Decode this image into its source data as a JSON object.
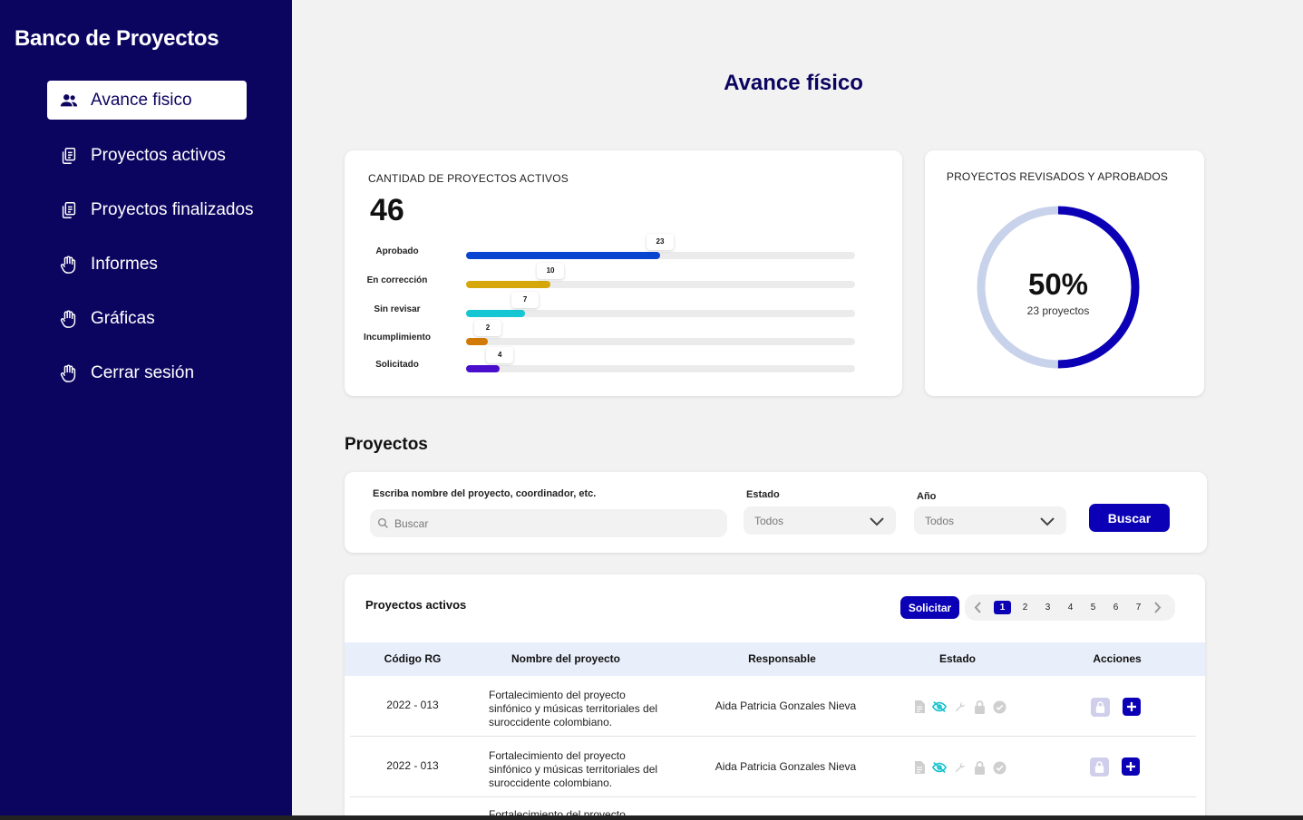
{
  "sidebar": {
    "brand": "Banco de Proyectos",
    "items": [
      {
        "label": "Avance fisico",
        "icon": "users-icon",
        "active": true
      },
      {
        "label": "Proyectos activos",
        "icon": "documents-icon"
      },
      {
        "label": "Proyectos finalizados",
        "icon": "documents-icon"
      },
      {
        "label": "Informes",
        "icon": "hand-icon"
      },
      {
        "label": "Gráficas",
        "icon": "hand-icon"
      },
      {
        "label": "Cerrar sesión",
        "icon": "hand-icon"
      }
    ],
    "colors": {
      "background": "#0c0560",
      "active_bg": "#ffffff"
    }
  },
  "main": {
    "title": "Avance físico"
  },
  "active_card": {
    "caption": "CANTIDAD DE PROYECTOS ACTIVOS",
    "total": "46",
    "bars": [
      {
        "label": "Aprobado",
        "value": 23,
        "value_label": "23",
        "color": "#0a45d1"
      },
      {
        "label": "En corrección",
        "value": 10,
        "value_label": "10",
        "color": "#d6a70a"
      },
      {
        "label": "Sin revisar",
        "value": 7,
        "value_label": "7",
        "color": "#16c6d2"
      },
      {
        "label": "Incumplimiento",
        "value": 2,
        "value_label": "2",
        "color": "#d17a05"
      },
      {
        "label": "Solicitado",
        "value": 4,
        "value_label": "4",
        "color": "#4a0fcc"
      }
    ],
    "scale_max": 46
  },
  "donut_card": {
    "caption": "PROYECTOS REVISADOS Y APROBADOS",
    "percent_label": "50%",
    "percent_value": 0.5,
    "sub": "23 proyectos",
    "colors": {
      "fill": "#0b00b5",
      "track": "#c8d2ea"
    }
  },
  "projects": {
    "title": "Proyectos",
    "search_label": "Escriba nombre del proyecto, coordinador, etc.",
    "search_placeholder": "Buscar",
    "estado_label": "Estado",
    "estado_value": "Todos",
    "anio_label": "Año",
    "anio_value": "Todos",
    "buscar_button": "Buscar"
  },
  "table": {
    "title": "Proyectos activos",
    "solicitar_button": "Solicitar",
    "pages": [
      "1",
      "2",
      "3",
      "4",
      "5",
      "6",
      "7"
    ],
    "current_page": "1",
    "headers": [
      "Código RG",
      "Nombre del proyecto",
      "Responsable",
      "Estado",
      "Acciones"
    ],
    "rows": [
      {
        "code": "2022 - 013",
        "name_lines": [
          "Fortalecimiento del proyecto",
          "sinfónico y músicas territoriales del",
          "suroccidente colombiano."
        ],
        "responsible": "Aida Patricia Gonzales Nieva"
      },
      {
        "code": "2022 - 013",
        "name_lines": [
          "Fortalecimiento del proyecto",
          "sinfónico y músicas territoriales del",
          "suroccidente colombiano."
        ],
        "responsible": "Aida Patricia Gonzales Nieva"
      },
      {
        "code": "",
        "name_lines": [
          "Fortalecimiento del proyecto",
          "",
          ""
        ],
        "responsible": ""
      }
    ],
    "status_icons": [
      "document-icon",
      "eye-off-icon",
      "wrench-icon",
      "lock-icon",
      "check-circle-icon"
    ],
    "accent": "#0b00b5"
  }
}
